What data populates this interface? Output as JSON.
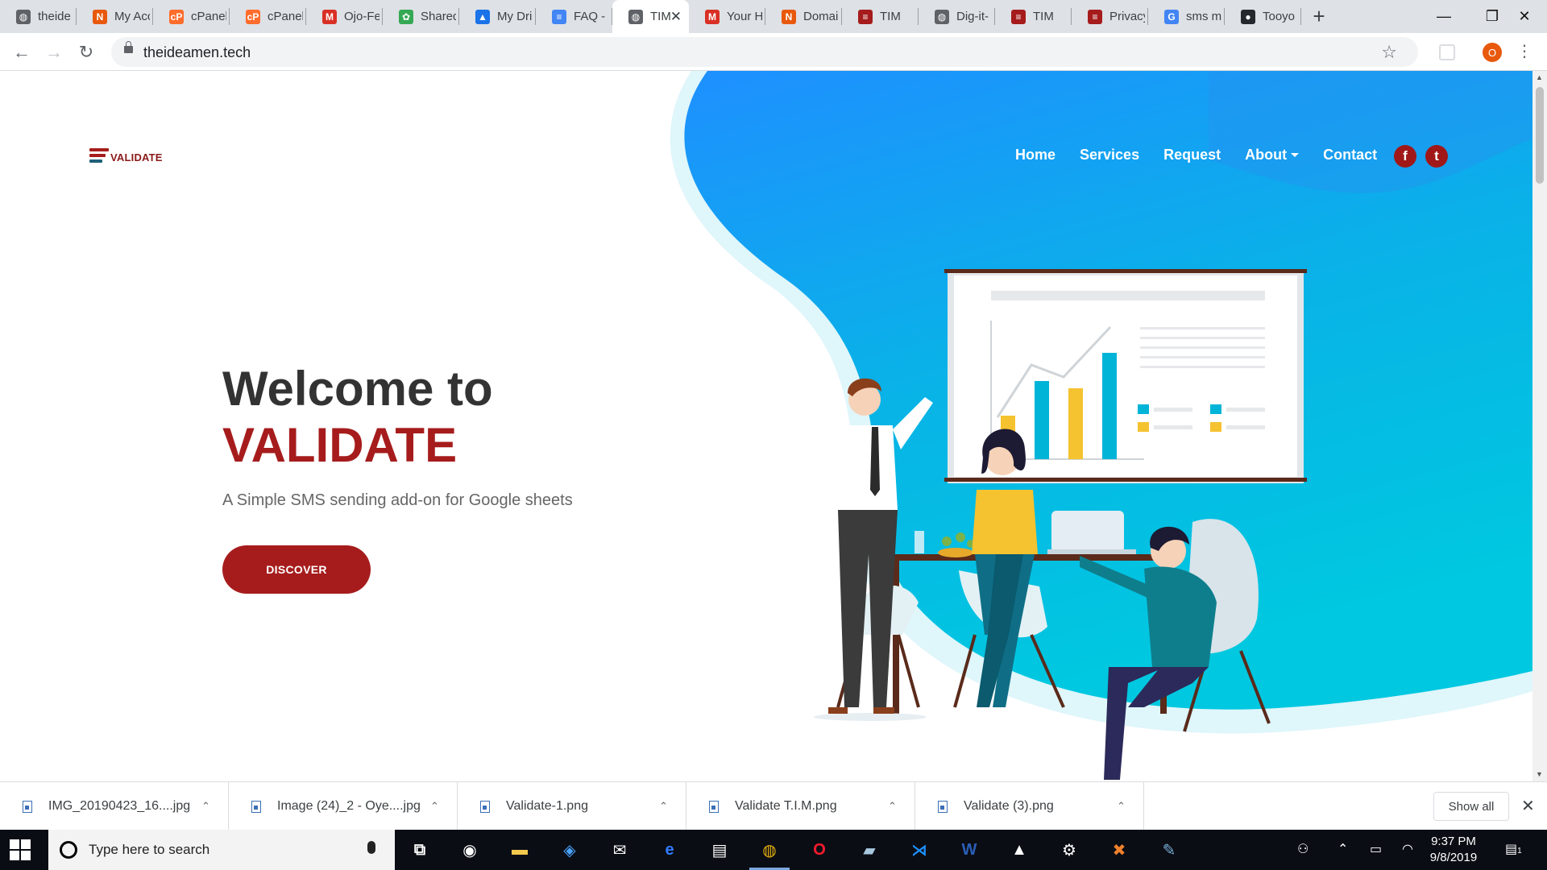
{
  "browser": {
    "tabs": [
      {
        "title": "theide",
        "favicon": "globe-icon",
        "color": "#5f6368",
        "glyph": "◍"
      },
      {
        "title": "My Acc",
        "favicon": "namecheap-icon",
        "color": "#e8590c",
        "glyph": "N"
      },
      {
        "title": "cPanel",
        "favicon": "cpanel-icon",
        "color": "#ff6c2c",
        "glyph": "cP"
      },
      {
        "title": "cPanel",
        "favicon": "cpanel-icon",
        "color": "#ff6c2c",
        "glyph": "cP"
      },
      {
        "title": "Ojo-Fe",
        "favicon": "gmail-icon",
        "color": "#d93025",
        "glyph": "M"
      },
      {
        "title": "Shared",
        "favicon": "photos-icon",
        "color": "#34a853",
        "glyph": "✿"
      },
      {
        "title": "My Dri",
        "favicon": "drive-icon",
        "color": "#1a73e8",
        "glyph": "▲"
      },
      {
        "title": "FAQ - ",
        "favicon": "docs-icon",
        "color": "#4285f4",
        "glyph": "≡"
      },
      {
        "title": "TIM",
        "favicon": "globe-icon",
        "color": "#5f6368",
        "glyph": "◍",
        "active": true
      },
      {
        "title": "Your H",
        "favicon": "gmail-icon",
        "color": "#d93025",
        "glyph": "M"
      },
      {
        "title": "Domai",
        "favicon": "namecheap-icon",
        "color": "#e8590c",
        "glyph": "N"
      },
      {
        "title": "TIM",
        "favicon": "validate-icon",
        "color": "#a61c1c",
        "glyph": "≡"
      },
      {
        "title": "Dig-it-",
        "favicon": "globe-icon",
        "color": "#5f6368",
        "glyph": "◍"
      },
      {
        "title": "TIM",
        "favicon": "validate-icon",
        "color": "#a61c1c",
        "glyph": "≡"
      },
      {
        "title": "Privacy",
        "favicon": "validate-icon",
        "color": "#a61c1c",
        "glyph": "≡"
      },
      {
        "title": "sms m",
        "favicon": "google-icon",
        "color": "#4285f4",
        "glyph": "G"
      },
      {
        "title": "Tooyo",
        "favicon": "github-icon",
        "color": "#24292e",
        "glyph": "●"
      }
    ],
    "new_tab": "+",
    "window_controls": {
      "minimize": "—",
      "maximize": "❐",
      "close": "✕"
    },
    "url": "theideamen.tech",
    "profile_initial": "O"
  },
  "site": {
    "logo_text": "VALIDATE",
    "nav": [
      "Home",
      "Services",
      "Request",
      "About",
      "Contact"
    ],
    "social": {
      "facebook": "f",
      "twitter": "t"
    },
    "hero": {
      "title_line1": "Welcome to",
      "title_line2": "VALIDATE",
      "subtitle": "A Simple SMS sending add-on for Google sheets",
      "cta": "DISCOVER"
    },
    "colors": {
      "brand_red": "#a61c1c",
      "blob_top": "#1e90ff",
      "blob_bottom": "#00c6e0"
    }
  },
  "downloads": {
    "items": [
      "IMG_20190423_16....jpg",
      "Image (24)_2 - Oye....jpg",
      "Validate-1.png",
      "Validate T.I.M.png",
      "Validate (3).png"
    ],
    "show_all": "Show all"
  },
  "taskbar": {
    "search_placeholder": "Type here to search",
    "time": "9:37 PM",
    "date": "9/8/2019",
    "notification_count": "1"
  }
}
